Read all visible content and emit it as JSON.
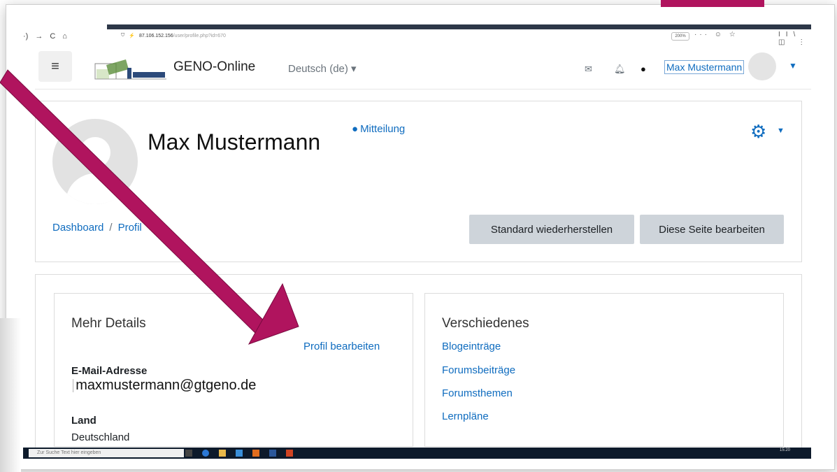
{
  "browser": {
    "nav_glyphs": [
      "·)",
      "→",
      "C",
      "⌂"
    ],
    "url_site": "87.106.152.156",
    "url_path": "/user/profile.php?id=670",
    "zoom": "200%",
    "right_icons": "··· ☺ ☆",
    "far_right_icons": "II\\ ◫ ⋮"
  },
  "header": {
    "site_name": "GENO-Online",
    "language": "Deutsch (de) ▾",
    "user_name": "Max Mustermann",
    "icons": [
      "menu-icon",
      "mail-icon",
      "bell-icon",
      "chat-icon",
      "caret-down-icon"
    ]
  },
  "profile": {
    "name": "Max Mustermann",
    "message_link": "Mitteilung",
    "breadcrumb": [
      "Dashboard",
      "Profil"
    ],
    "breadcrumb_sep": "/",
    "btn_reset": "Standard wiederherstellen",
    "btn_edit": "Diese Seite bearbeiten"
  },
  "details": {
    "title": "Mehr Details",
    "edit_link": "Profil bearbeiten",
    "email_label": "E-Mail-Adresse",
    "email_value": "maxmustermann@gtgeno.de",
    "country_label": "Land",
    "country_value": "Deutschland"
  },
  "misc": {
    "title": "Verschiedenes",
    "links": [
      "Blogeinträge",
      "Forumsbeiträge",
      "Forumsthemen",
      "Lernpläne"
    ]
  },
  "taskbar": {
    "search_placeholder": "Zur Suche Text hier eingeben",
    "time": "15:20"
  },
  "colors": {
    "accent": "#0f6cbf",
    "arrow": "#b0145e",
    "button": "#ced4da"
  }
}
